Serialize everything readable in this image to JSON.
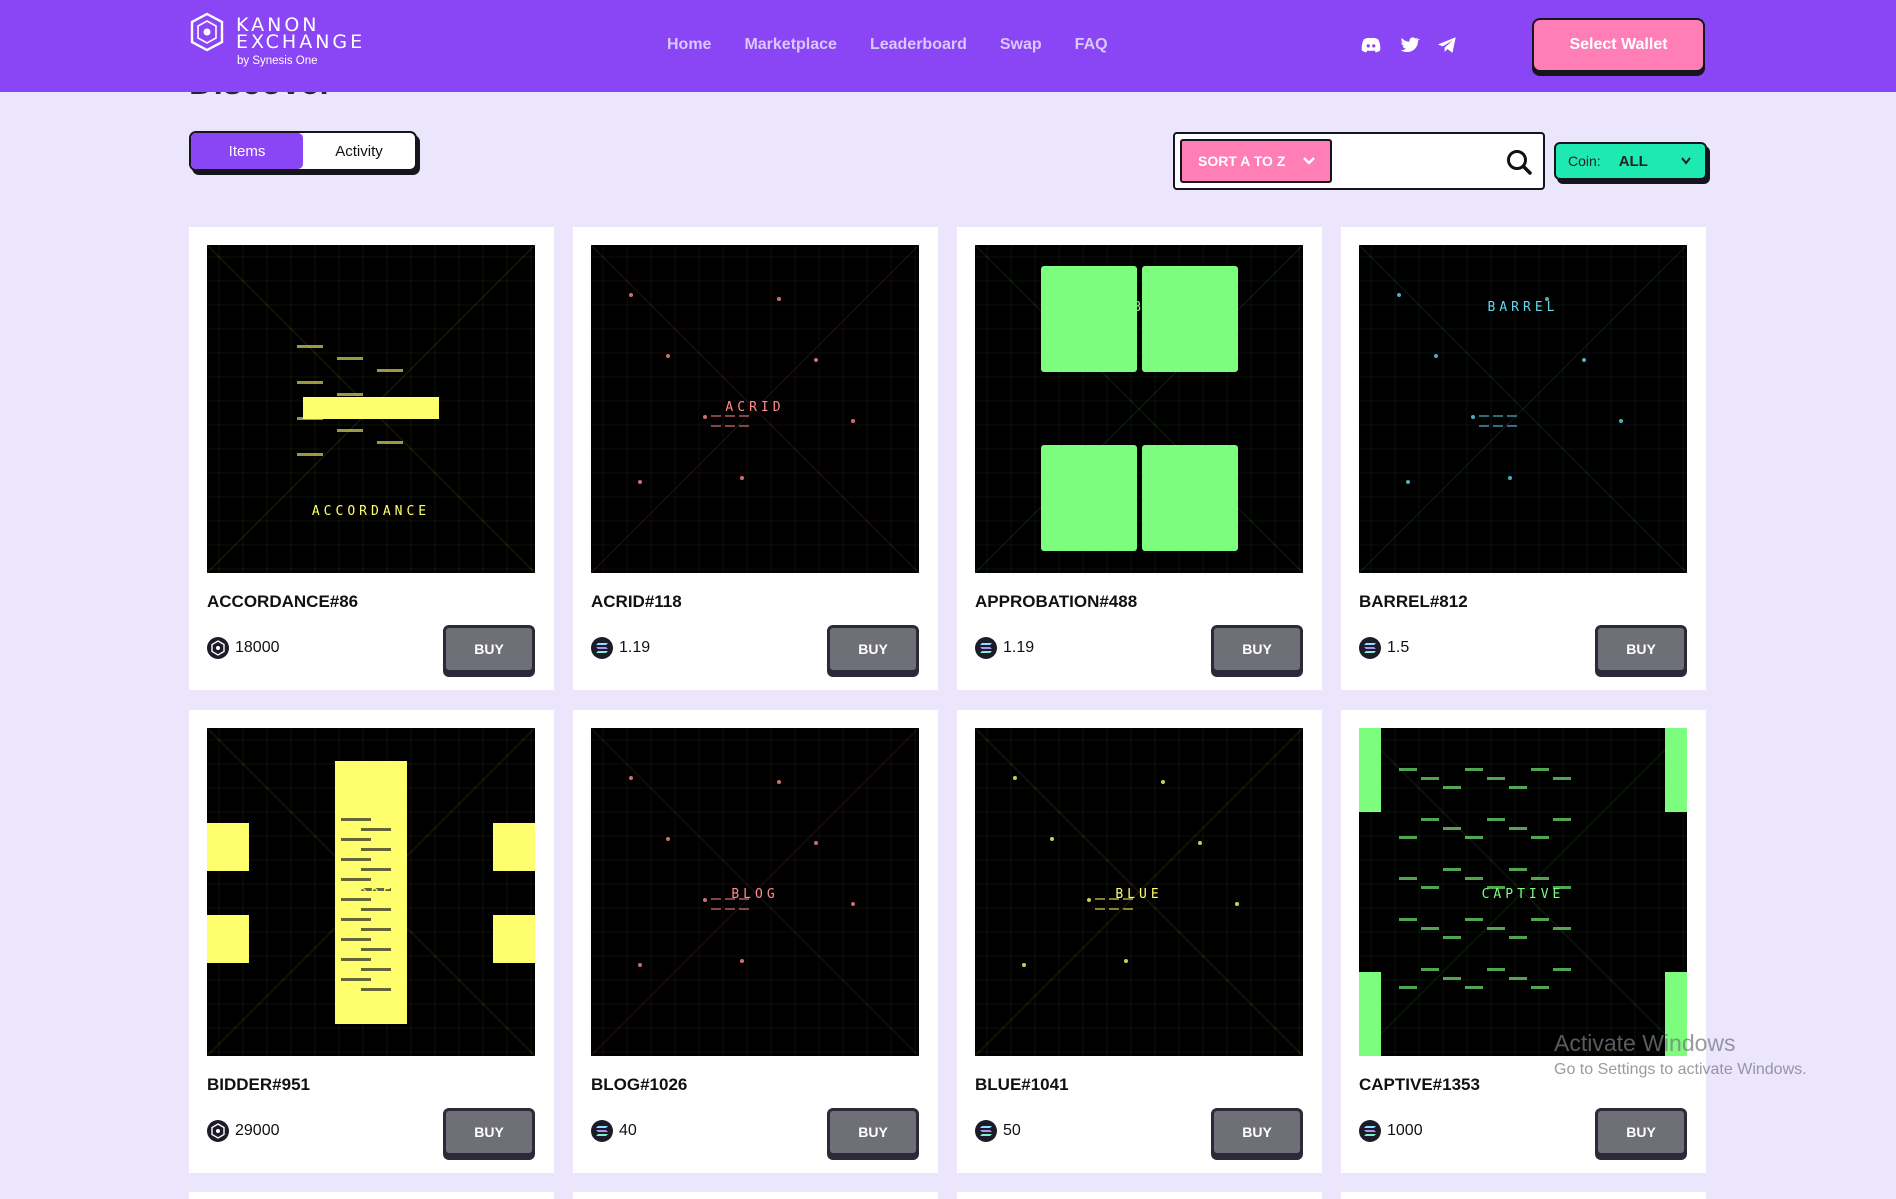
{
  "header": {
    "logo_line1": "KANON",
    "logo_line2": "EXCHANGE",
    "logo_sub": "by Synesis One",
    "nav": [
      "Home",
      "Marketplace",
      "Leaderboard",
      "Swap",
      "FAQ"
    ],
    "social_icons": [
      "discord-icon",
      "twitter-icon",
      "telegram-icon"
    ],
    "wallet_button": "Select Wallet"
  },
  "page": {
    "heading": "Discover",
    "tabs": [
      {
        "label": "Items",
        "active": true
      },
      {
        "label": "Activity",
        "active": false
      }
    ],
    "sort_label": "SORT A TO Z",
    "search_value": "",
    "coin_label": "Coin:",
    "coin_value": "ALL",
    "buy_label": "BUY"
  },
  "colors": {
    "header": "#8a45f5",
    "background": "#ece6fd",
    "pink": "#ff7eb6",
    "teal": "#1ee9b1"
  },
  "items": [
    {
      "name": "ACCORDANCE#86",
      "word": "ACCORDANCE",
      "price": "18000",
      "coin": "kanon",
      "accent": "#ffff6e"
    },
    {
      "name": "ACRID#118",
      "word": "ACRID",
      "price": "1.19",
      "coin": "sol",
      "accent": "#ff8b8b"
    },
    {
      "name": "APPROBATION#488",
      "word": "APPROBATION",
      "price": "1.19",
      "coin": "sol",
      "accent": "#7dfd7d"
    },
    {
      "name": "BARREL#812",
      "word": "BARREL",
      "price": "1.5",
      "coin": "sol",
      "accent": "#66d7e8"
    },
    {
      "name": "BIDDER#951",
      "word": "BIDDER",
      "price": "29000",
      "coin": "kanon",
      "accent": "#ffff6e"
    },
    {
      "name": "BLOG#1026",
      "word": "BLOG",
      "price": "40",
      "coin": "sol",
      "accent": "#ff8b8b"
    },
    {
      "name": "BLUE#1041",
      "word": "BLUE",
      "price": "50",
      "coin": "sol",
      "accent": "#ffff6e"
    },
    {
      "name": "CAPTIVE#1353",
      "word": "CAPTIVE",
      "price": "1000",
      "coin": "sol",
      "accent": "#7dfd7d"
    }
  ],
  "watermark": {
    "line1": "Activate Windows",
    "line2": "Go to Settings to activate Windows."
  }
}
